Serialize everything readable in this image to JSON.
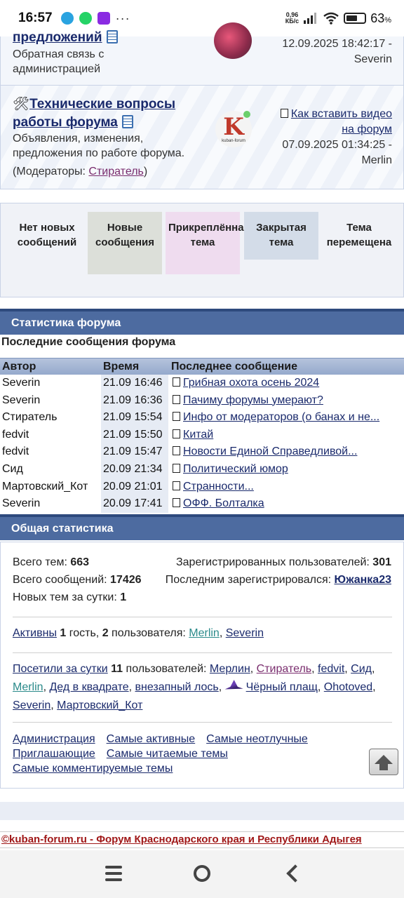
{
  "status_bar": {
    "time": "16:57",
    "net_speed_value": "0,96",
    "net_speed_unit": "КБ/с",
    "battery_percent": "63",
    "battery_unit": "%",
    "battery_level": 0.63,
    "more_icon": "···"
  },
  "forum_rows": [
    {
      "title": "предложений",
      "description": "Обратная связь с администрацией",
      "last_date": "12.09.2025 18:42:17 -",
      "last_user": "Severin"
    },
    {
      "title_emoji": "🛠",
      "title": "Технические вопросы работы форума",
      "description": "Объявления, изменения, предложения по работе форума.",
      "moderators_label": "(Модераторы: ",
      "moderator": "Стиратель",
      "moderators_end": ")",
      "last_topic": "Как вставить видео на форум",
      "last_date": "07.09.2025 01:34:25 -",
      "last_user": "Merlin",
      "avatar_letter": "K",
      "avatar_caption": "kuban-forum"
    }
  ],
  "legend": [
    {
      "label": "Нет новых сообщений",
      "color": "#f0f2f7"
    },
    {
      "label": "Новые сообщения",
      "color": "#dcdfd9"
    },
    {
      "label": "Прикреплённая тема",
      "color": "#efdcef"
    },
    {
      "label": "Закрытая тема",
      "color": "#d3dce8"
    },
    {
      "label": "Тема перемещена",
      "color": "#f0f2f7"
    }
  ],
  "stats": {
    "header": "Статистика форума",
    "recent_title": "Последние сообщения форума",
    "columns": [
      "Автор",
      "Время",
      "Последнее сообщение"
    ],
    "rows": [
      {
        "author": "Severin",
        "time": "21.09 16:46",
        "message": "Грибная охота осень 2024"
      },
      {
        "author": "Severin",
        "time": "21.09 16:36",
        "message": "Пачиму форумы умерают?"
      },
      {
        "author": "Стиратель",
        "time": "21.09 15:54",
        "message": "Инфо от модераторов (о банах и не..."
      },
      {
        "author": "fedvit",
        "time": "21.09 15:50",
        "message": "Китай"
      },
      {
        "author": "fedvit",
        "time": "21.09 15:47",
        "message": "Новости Единой Справедливой..."
      },
      {
        "author": "Сид",
        "time": "20.09 21:34",
        "message": "Политический юмор"
      },
      {
        "author": "Мартовский_Кот",
        "time": "20.09 21:01",
        "message": "Странности..."
      },
      {
        "author": "Severin",
        "time": "20.09 17:41",
        "message": "ОФФ. Болталка"
      }
    ]
  },
  "general": {
    "header": "Общая статистика",
    "total_topics_label": "Всего тем: ",
    "total_topics": "663",
    "total_posts_label": "Всего сообщений: ",
    "total_posts": "17426",
    "new_topics_label": "Новых тем за сутки: ",
    "new_topics": "1",
    "registered_label": "Зарегистрированных пользователей: ",
    "registered": "301",
    "last_registered_label": "Последним зарегистрировался: ",
    "last_registered": "Южанка23",
    "active_link": "Активны",
    "active_guests": "1",
    "active_guests_label": " гость, ",
    "active_users": "2",
    "active_users_label": " пользователя: ",
    "active_list": [
      "Merlin",
      "Severin"
    ],
    "visited_link": "Посетили за сутки",
    "visited_count": "11",
    "visited_label": " пользователей: ",
    "visitors": [
      {
        "name": "Мерлин",
        "style": "link"
      },
      {
        "name": "Стиратель",
        "style": "purple"
      },
      {
        "name": "fedvit",
        "style": "link"
      },
      {
        "name": "Сид",
        "style": "link"
      },
      {
        "name": "Merlin",
        "style": "teal"
      },
      {
        "name": "Дед в квадрате",
        "style": "link"
      },
      {
        "name": "внезапный лось",
        "style": "link"
      },
      {
        "name": "Чёрный плащ",
        "style": "link"
      },
      {
        "name": "Ohotoved",
        "style": "link"
      },
      {
        "name": "Severin",
        "style": "link"
      },
      {
        "name": "Мартовский_Кот",
        "style": "link"
      }
    ],
    "footer_links": [
      "Администрация",
      "Самые активные",
      "Самые неотлучные",
      "Приглашающие",
      "Самые читаемые темы",
      "Самые комментируемые темы"
    ]
  },
  "footer": {
    "text": "©kuban-forum.ru - Форум Краснодарского края и Республики Адыгея"
  },
  "icons": {
    "doc": "document-icon",
    "note": "notepad-icon",
    "tools": "tools-icon"
  }
}
